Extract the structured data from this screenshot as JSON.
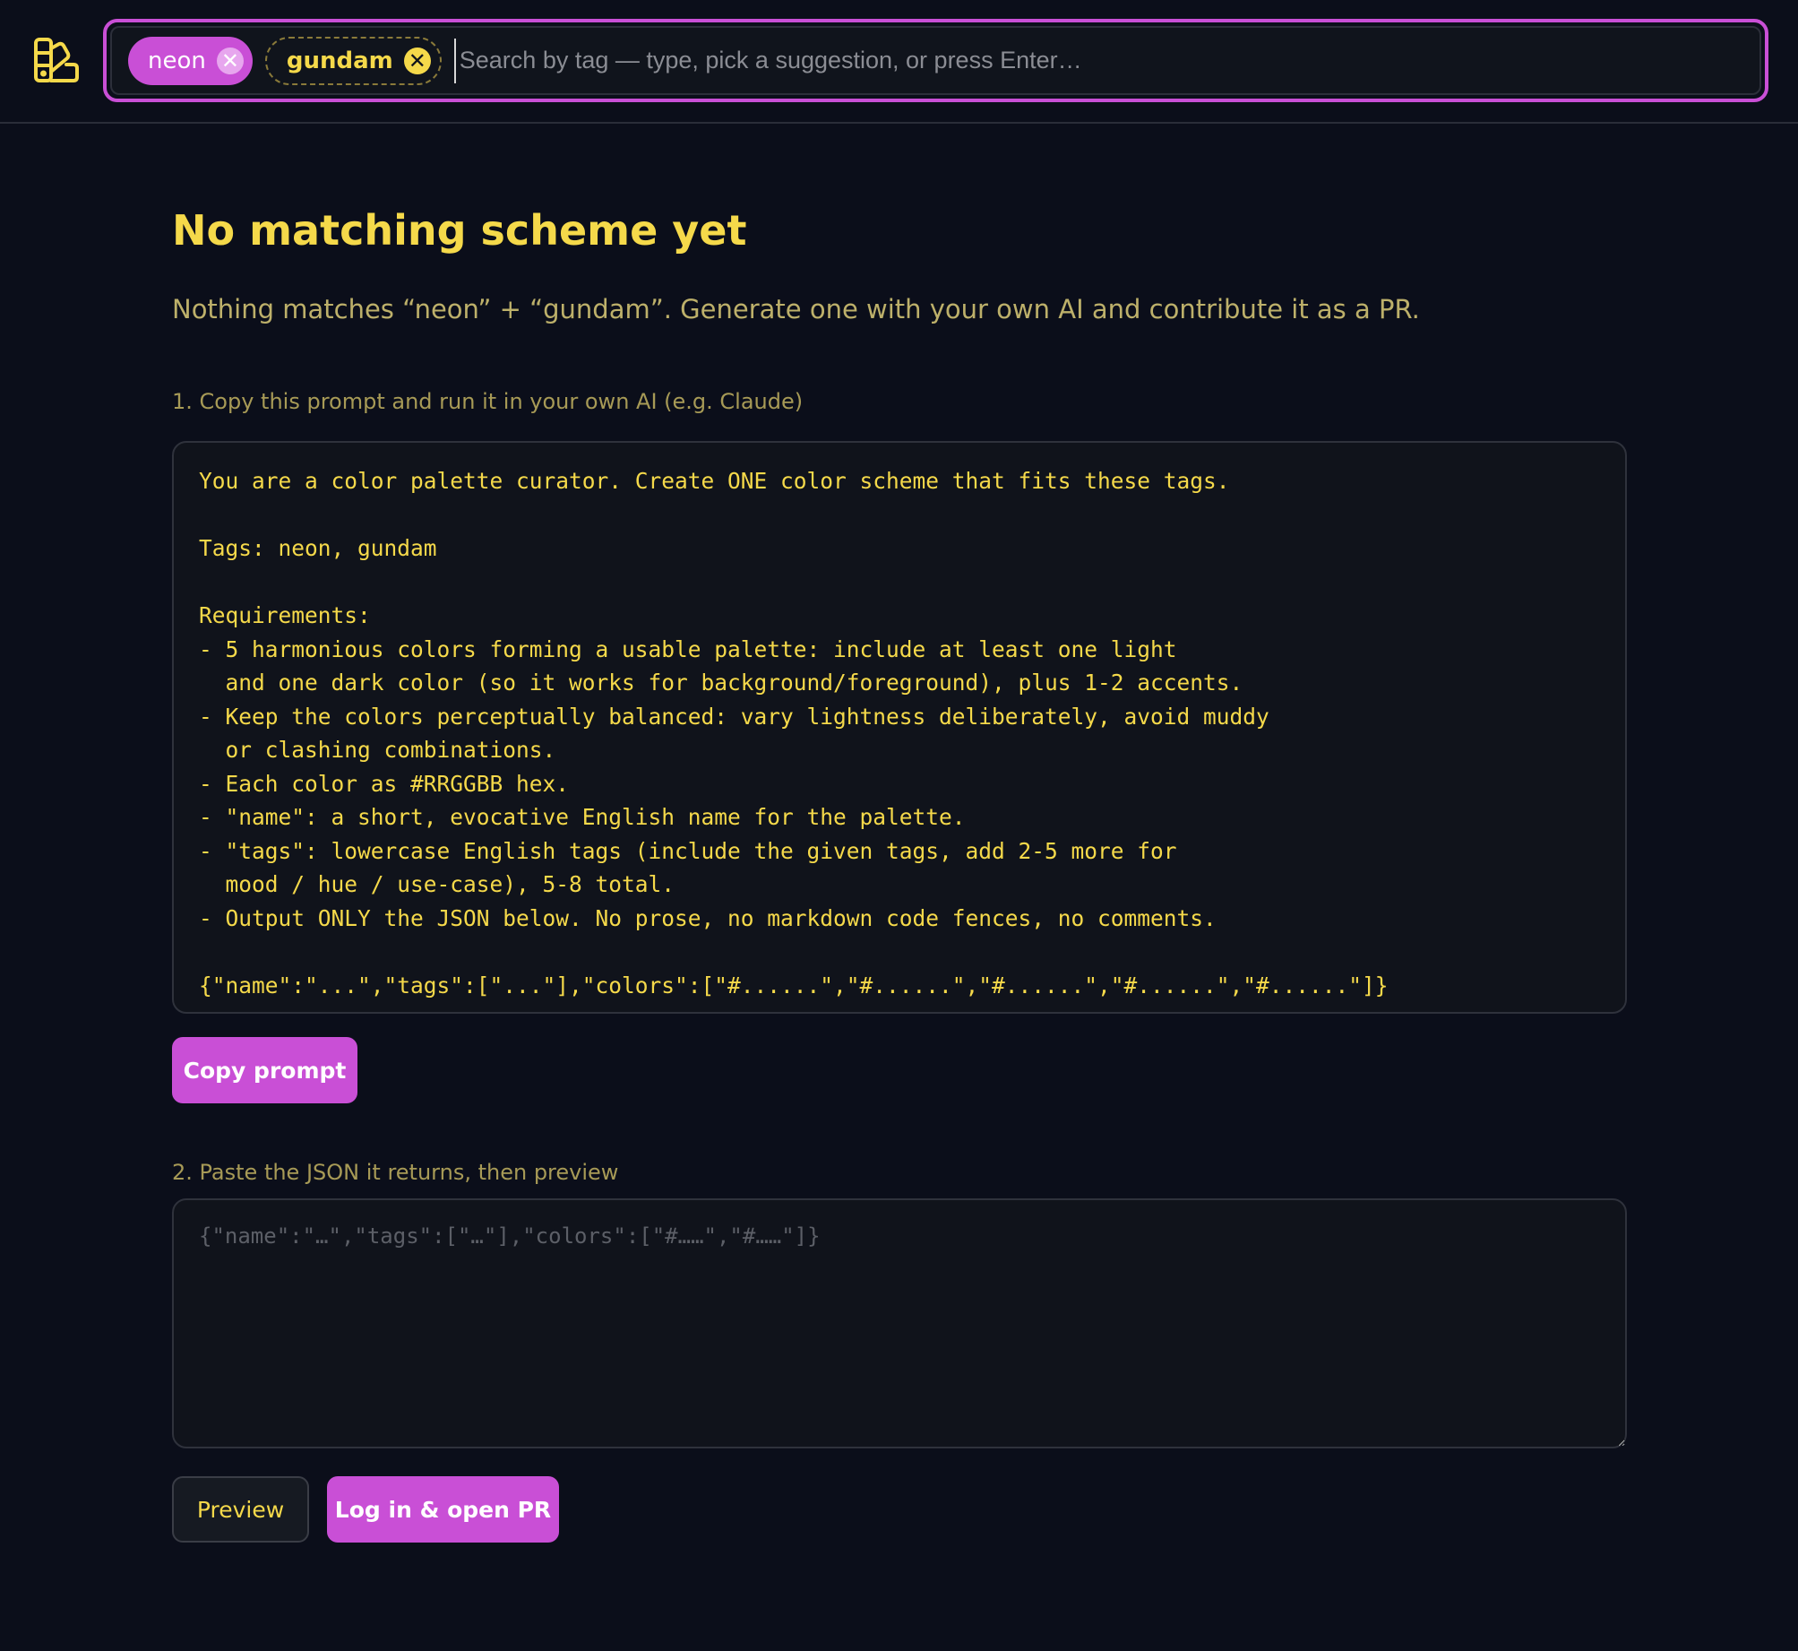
{
  "header": {
    "logo_icon": "palette-swatch-icon",
    "tags": [
      {
        "label": "neon",
        "style": "filled",
        "remove_icon": "close-icon"
      },
      {
        "label": "gundam",
        "style": "dashed",
        "remove_icon": "close-icon"
      }
    ],
    "search": {
      "placeholder": "Search by tag — type, pick a suggestion, or press Enter…",
      "value": ""
    }
  },
  "main": {
    "title": "No matching scheme yet",
    "subtitle": "Nothing matches “neon” + “gundam”. Generate one with your own AI and contribute it as a PR.",
    "step1_label": "1. Copy this prompt and run it in your own AI (e.g. Claude)",
    "prompt_text": "You are a color palette curator. Create ONE color scheme that fits these tags.\n\nTags: neon, gundam\n\nRequirements:\n- 5 harmonious colors forming a usable palette: include at least one light\n  and one dark color (so it works for background/foreground), plus 1-2 accents.\n- Keep the colors perceptually balanced: vary lightness deliberately, avoid muddy\n  or clashing combinations.\n- Each color as #RRGGBB hex.\n- \"name\": a short, evocative English name for the palette.\n- \"tags\": lowercase English tags (include the given tags, add 2-5 more for\n  mood / hue / use-case), 5-8 total.\n- Output ONLY the JSON below. No prose, no markdown code fences, no comments.\n\n{\"name\":\"...\",\"tags\":[\"...\"],\"colors\":[\"#......\",\"#......\",\"#......\",\"#......\",\"#......\"]}",
    "copy_button": "Copy prompt",
    "step2_label": "2. Paste the JSON it returns, then preview",
    "json_placeholder": "{\"name\":\"…\",\"tags\":[\"…\"],\"colors\":[\"#……\",\"#……\"]}",
    "json_value": "",
    "preview_button": "Preview",
    "pr_button": "Log in & open PR"
  },
  "colors": {
    "background": "#0b0e1a",
    "accent": "#c94fd6",
    "text": "#f5d94a",
    "muted_text": "#a79a56",
    "panel": "#10131b"
  }
}
